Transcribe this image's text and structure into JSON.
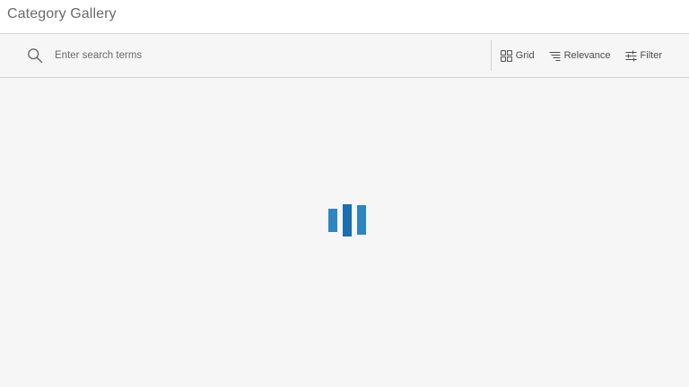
{
  "header": {
    "title": "Category Gallery"
  },
  "search": {
    "placeholder": "Enter search terms",
    "value": "",
    "icon": "search-icon"
  },
  "toolbar": {
    "grid_label": "Grid",
    "relevance_label": "Relevance",
    "filter_label": "Filter"
  },
  "loader": {
    "state": "loading",
    "color": "#2e86c1",
    "accent": "#1a6fb0"
  },
  "colors": {
    "background": "#f6f6f6",
    "header_bg": "#ffffff",
    "border": "#d3d3d3",
    "text": "#4c4c4c"
  }
}
